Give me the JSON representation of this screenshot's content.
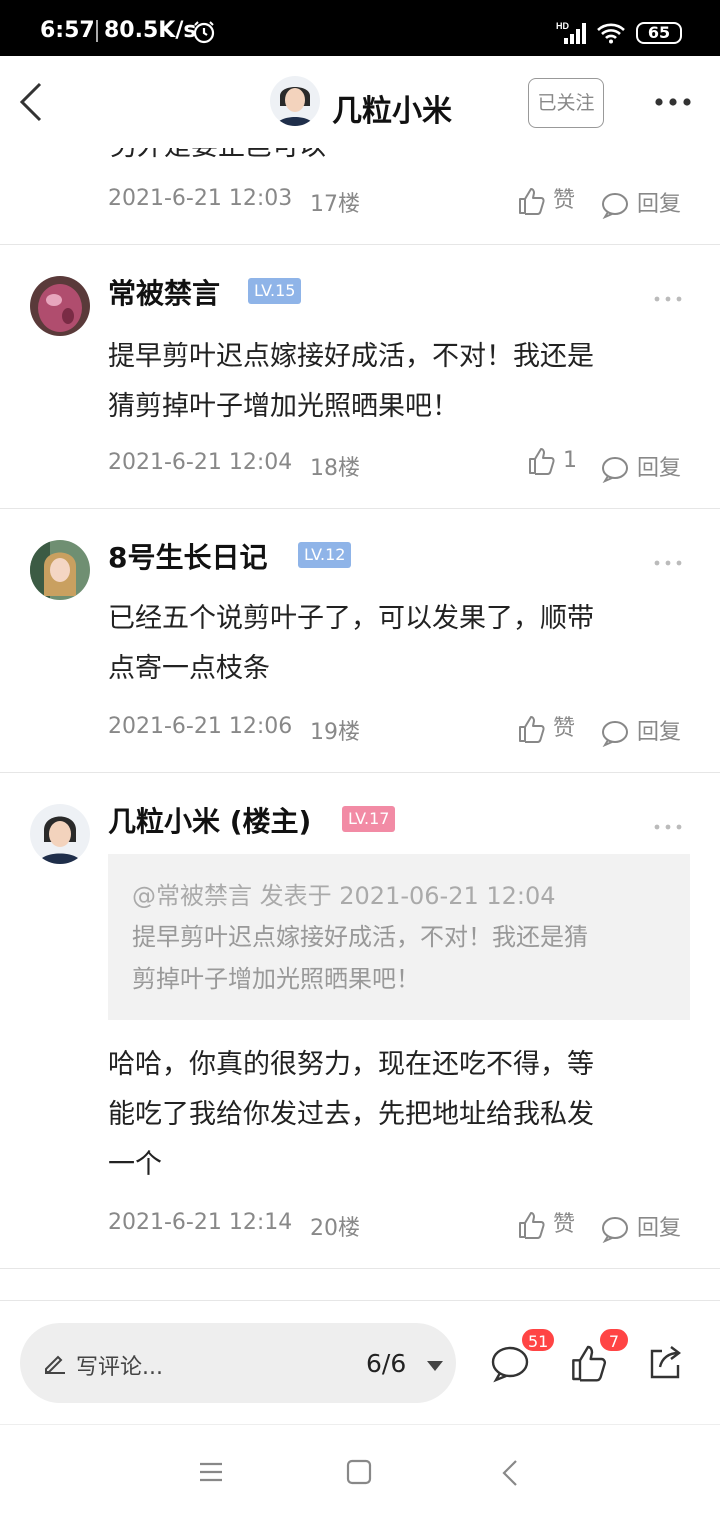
{
  "status_bar": {
    "time": "6:57",
    "speed": "80.5K/s",
    "signal_label": "HD",
    "battery": "65",
    "icons": [
      "alarm-icon",
      "signal-icon",
      "wifi-icon",
      "battery-icon"
    ]
  },
  "header": {
    "title": "几粒小米",
    "follow_label": "已关注",
    "icons": [
      "back-arrow-icon",
      "more-icon"
    ]
  },
  "thread": {
    "partial_text": "另外是要正邑可以",
    "partial_post": {
      "time": "2021-6-21 12:03",
      "floor": "17楼",
      "like_label": "赞",
      "reply_label": "回复"
    },
    "posts": [
      {
        "username": "常被禁言",
        "level": "LV.15",
        "content_lines": [
          "提早剪叶迟点嫁接好成活，不对！我还是",
          "猜剪掉叶子增加光照晒果吧！"
        ],
        "time": "2021-6-21 12:04",
        "floor": "18楼",
        "like_label": "1",
        "reply_label": "回复"
      },
      {
        "username": "8号生长日记",
        "level": "LV.12",
        "content_lines": [
          "已经五个说剪叶子了，可以发果了，顺带",
          "点寄一点枝条"
        ],
        "time": "2021-6-21 12:06",
        "floor": "19楼",
        "like_label": "赞",
        "reply_label": "回复"
      },
      {
        "username": "几粒小米 (楼主)",
        "level": "LV.17",
        "quote_header": "@常被禁言 发表于 2021-06-21 12:04",
        "quote_lines": [
          "提早剪叶迟点嫁接好成活，不对！我还是猜",
          "剪掉叶子增加光照晒果吧！"
        ],
        "content_lines": [
          "哈哈，你真的很努力，现在还吃不得，等",
          "能吃了我给你发过去，先把地址给我私发",
          "一个"
        ],
        "time": "2021-6-21 12:14",
        "floor": "20楼",
        "like_label": "赞",
        "reply_label": "回复"
      }
    ]
  },
  "bottom_bar": {
    "comment_placeholder": "写评论...",
    "page_indicator": "6/6",
    "comment_count": "51",
    "like_count": "7"
  },
  "colors": {
    "level_blue": "#8fb4e8",
    "level_pink": "#f28ba5",
    "badge_red": "#ff4d4d"
  }
}
